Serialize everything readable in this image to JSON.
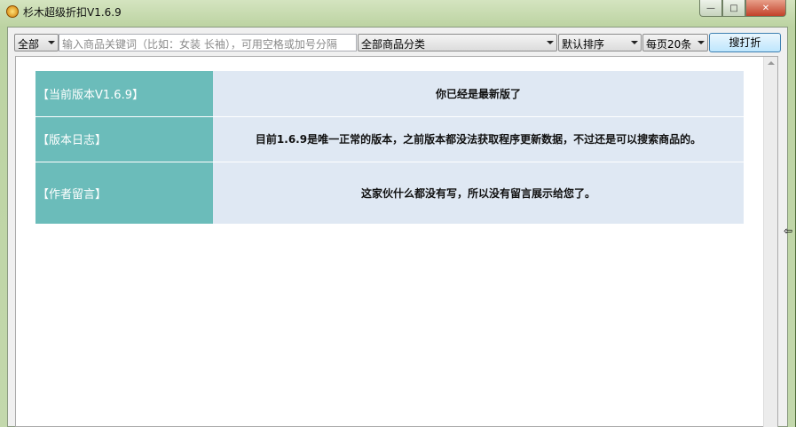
{
  "window": {
    "title": "杉木超级折扣V1.6.9",
    "min": "▭",
    "max": "□",
    "close": "✕"
  },
  "toolbar": {
    "scope": "全部",
    "search_placeholder": "输入商品关键词（比如：女装 长袖），可用空格或加号分隔",
    "category": "全部商品分类",
    "sort": "默认排序",
    "per_page": "每页20条",
    "search_button": "搜打折"
  },
  "info": [
    {
      "label": "【当前版本V1.6.9】",
      "value": "你已经是最新版了"
    },
    {
      "label": "【版本日志】",
      "value": "目前1.6.9是唯一正常的版本，之前版本都没法获取程序更新数据，不过还是可以搜索商品的。"
    },
    {
      "label": "【作者留言】",
      "value": "这家伙什么都没有写，所以没有留言展示给您了。"
    }
  ]
}
